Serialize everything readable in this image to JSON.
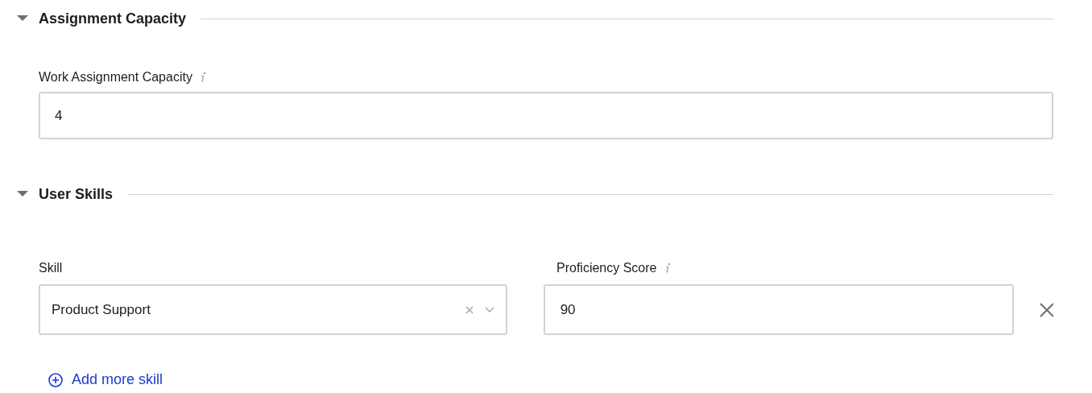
{
  "sections": [
    {
      "kind": "capacity",
      "title": "Assignment Capacity",
      "expanded": true,
      "field": {
        "label": "Work Assignment Capacity",
        "value": "4"
      }
    },
    {
      "kind": "skills",
      "title": "User Skills",
      "expanded": true,
      "skill_label": "Skill",
      "score_label": "Proficiency Score",
      "rows": [
        {
          "skill": "Product Support",
          "score": "90"
        }
      ],
      "add_link": "Add more skill"
    }
  ]
}
